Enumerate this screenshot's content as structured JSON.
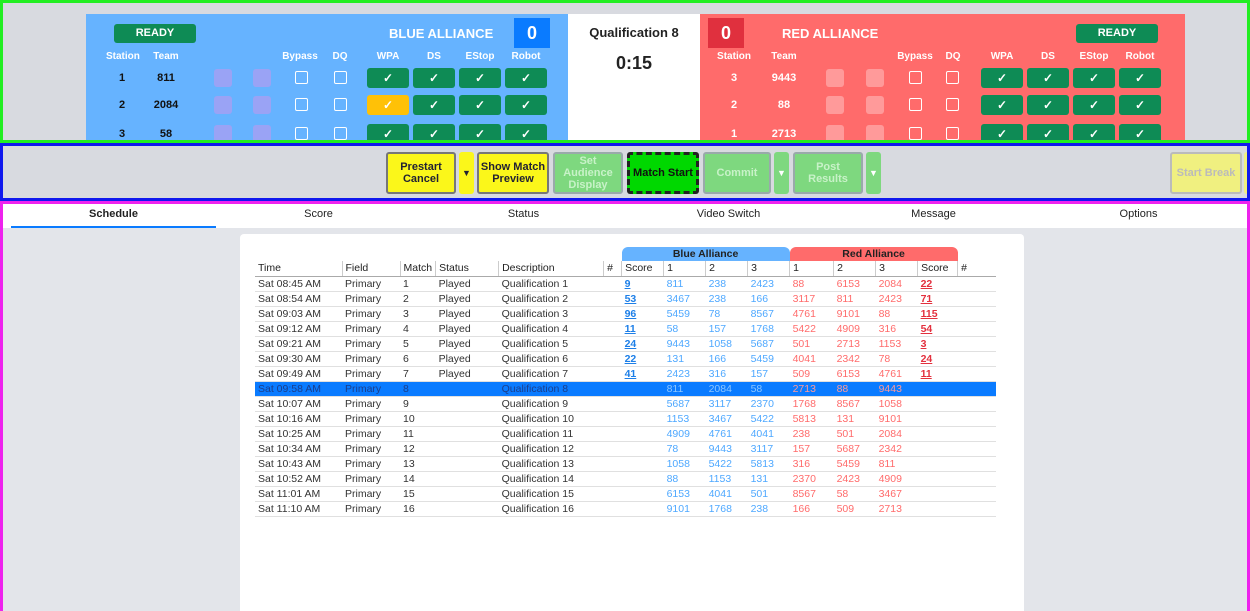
{
  "blue": {
    "ready": "READY",
    "label": "BLUE ALLIANCE",
    "score": "0",
    "headers": {
      "station": "Station",
      "team": "Team",
      "bypass": "Bypass",
      "dq": "DQ",
      "wpa": "WPA",
      "ds": "DS",
      "estop": "EStop",
      "robot": "Robot"
    },
    "rows": [
      {
        "station": "1",
        "team": "811",
        "wpa_warning": false
      },
      {
        "station": "2",
        "team": "2084",
        "wpa_warning": true
      },
      {
        "station": "3",
        "team": "58",
        "wpa_warning": false
      }
    ]
  },
  "red": {
    "ready": "READY",
    "label": "RED ALLIANCE",
    "score": "0",
    "headers": {
      "station": "Station",
      "team": "Team",
      "bypass": "Bypass",
      "dq": "DQ",
      "wpa": "WPA",
      "ds": "DS",
      "estop": "EStop",
      "robot": "Robot"
    },
    "rows": [
      {
        "station": "3",
        "team": "9443"
      },
      {
        "station": "2",
        "team": "88"
      },
      {
        "station": "1",
        "team": "2713"
      }
    ]
  },
  "match": {
    "name": "Qualification 8",
    "time": "0:15"
  },
  "check_glyph": "✓",
  "controls": {
    "prestart_cancel": "Prestart Cancel",
    "show_match_preview": "Show Match Preview",
    "set_audience_display": "Set Audience Display",
    "match_start": "Match Start",
    "commit": "Commit",
    "post_results": "Post Results",
    "start_break": "Start Break"
  },
  "tabs": [
    "Schedule",
    "Score",
    "Status",
    "Video Switch",
    "Message",
    "Options"
  ],
  "schedule": {
    "group_blue": "Blue Alliance",
    "group_red": "Red Alliance",
    "columns": [
      "Time",
      "Field",
      "Match",
      "Status",
      "Description",
      "#",
      "Score",
      "1",
      "2",
      "3",
      "1",
      "2",
      "3",
      "Score",
      "#"
    ],
    "rows": [
      {
        "time": "Sat 08:45 AM",
        "field": "Primary",
        "match": "1",
        "status": "Played",
        "desc": "Qualification 1",
        "bscore": "9",
        "b1": "811",
        "b2": "238",
        "b3": "2423",
        "r1": "88",
        "r2": "6153",
        "r3": "2084",
        "rscore": "22"
      },
      {
        "time": "Sat 08:54 AM",
        "field": "Primary",
        "match": "2",
        "status": "Played",
        "desc": "Qualification 2",
        "bscore": "53",
        "b1": "3467",
        "b2": "238",
        "b3": "166",
        "r1": "3117",
        "r2": "811",
        "r3": "2423",
        "rscore": "71"
      },
      {
        "time": "Sat 09:03 AM",
        "field": "Primary",
        "match": "3",
        "status": "Played",
        "desc": "Qualification 3",
        "bscore": "96",
        "b1": "5459",
        "b2": "78",
        "b3": "8567",
        "r1": "4761",
        "r2": "9101",
        "r3": "88",
        "rscore": "115"
      },
      {
        "time": "Sat 09:12 AM",
        "field": "Primary",
        "match": "4",
        "status": "Played",
        "desc": "Qualification 4",
        "bscore": "11",
        "b1": "58",
        "b2": "157",
        "b3": "1768",
        "r1": "5422",
        "r2": "4909",
        "r3": "316",
        "rscore": "54"
      },
      {
        "time": "Sat 09:21 AM",
        "field": "Primary",
        "match": "5",
        "status": "Played",
        "desc": "Qualification 5",
        "bscore": "24",
        "b1": "9443",
        "b2": "1058",
        "b3": "5687",
        "r1": "501",
        "r2": "2713",
        "r3": "1153",
        "rscore": "3"
      },
      {
        "time": "Sat 09:30 AM",
        "field": "Primary",
        "match": "6",
        "status": "Played",
        "desc": "Qualification 6",
        "bscore": "22",
        "b1": "131",
        "b2": "166",
        "b3": "5459",
        "r1": "4041",
        "r2": "2342",
        "r3": "78",
        "rscore": "24"
      },
      {
        "time": "Sat 09:49 AM",
        "field": "Primary",
        "match": "7",
        "status": "Played",
        "desc": "Qualification 7",
        "bscore": "41",
        "b1": "2423",
        "b2": "316",
        "b3": "157",
        "r1": "509",
        "r2": "6153",
        "r3": "4761",
        "rscore": "11"
      },
      {
        "time": "Sat 09:58 AM",
        "field": "Primary",
        "match": "8",
        "status": "",
        "desc": "Qualification 8",
        "bscore": "",
        "b1": "811",
        "b2": "2084",
        "b3": "58",
        "r1": "2713",
        "r2": "88",
        "r3": "9443",
        "rscore": "",
        "selected": true
      },
      {
        "time": "Sat 10:07 AM",
        "field": "Primary",
        "match": "9",
        "status": "",
        "desc": "Qualification 9",
        "bscore": "",
        "b1": "5687",
        "b2": "3117",
        "b3": "2370",
        "r1": "1768",
        "r2": "8567",
        "r3": "1058",
        "rscore": ""
      },
      {
        "time": "Sat 10:16 AM",
        "field": "Primary",
        "match": "10",
        "status": "",
        "desc": "Qualification 10",
        "bscore": "",
        "b1": "1153",
        "b2": "3467",
        "b3": "5422",
        "r1": "5813",
        "r2": "131",
        "r3": "9101",
        "rscore": ""
      },
      {
        "time": "Sat 10:25 AM",
        "field": "Primary",
        "match": "11",
        "status": "",
        "desc": "Qualification 11",
        "bscore": "",
        "b1": "4909",
        "b2": "4761",
        "b3": "4041",
        "r1": "238",
        "r2": "501",
        "r3": "2084",
        "rscore": ""
      },
      {
        "time": "Sat 10:34 AM",
        "field": "Primary",
        "match": "12",
        "status": "",
        "desc": "Qualification 12",
        "bscore": "",
        "b1": "78",
        "b2": "9443",
        "b3": "3117",
        "r1": "157",
        "r2": "5687",
        "r3": "2342",
        "rscore": ""
      },
      {
        "time": "Sat 10:43 AM",
        "field": "Primary",
        "match": "13",
        "status": "",
        "desc": "Qualification 13",
        "bscore": "",
        "b1": "1058",
        "b2": "5422",
        "b3": "5813",
        "r1": "316",
        "r2": "5459",
        "r3": "811",
        "rscore": ""
      },
      {
        "time": "Sat 10:52 AM",
        "field": "Primary",
        "match": "14",
        "status": "",
        "desc": "Qualification 14",
        "bscore": "",
        "b1": "88",
        "b2": "1153",
        "b3": "131",
        "r1": "2370",
        "r2": "2423",
        "r3": "4909",
        "rscore": ""
      },
      {
        "time": "Sat 11:01 AM",
        "field": "Primary",
        "match": "15",
        "status": "",
        "desc": "Qualification 15",
        "bscore": "",
        "b1": "6153",
        "b2": "4041",
        "b3": "501",
        "r1": "8567",
        "r2": "58",
        "r3": "3467",
        "rscore": ""
      },
      {
        "time": "Sat 11:10 AM",
        "field": "Primary",
        "match": "16",
        "status": "",
        "desc": "Qualification 16",
        "bscore": "",
        "b1": "9101",
        "b2": "1768",
        "b3": "238",
        "r1": "166",
        "r2": "509",
        "r3": "2713",
        "rscore": ""
      }
    ]
  }
}
